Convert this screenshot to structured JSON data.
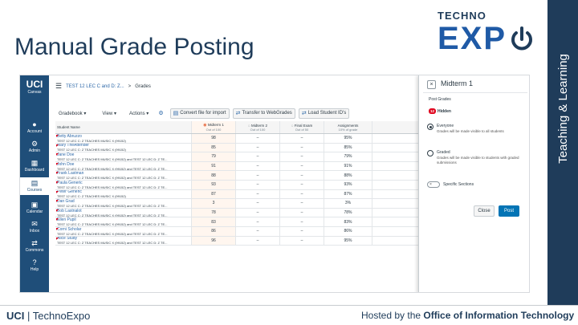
{
  "slide": {
    "title": "Manual Grade Posting",
    "logo_top": "TECHNO",
    "logo_main": "EXP",
    "side_text": "Teaching & Learning",
    "footer_left_a": "UCI",
    "footer_left_b": " | TechnoExpo",
    "footer_right_a": "Hosted by the ",
    "footer_right_b": "Office of Information Technology"
  },
  "nav": {
    "logo": "UCI",
    "logo_sub": "Canvas",
    "items": [
      {
        "label": "Account",
        "icon": "account-icon"
      },
      {
        "label": "Admin",
        "icon": "admin-icon"
      },
      {
        "label": "Dashboard",
        "icon": "dashboard-icon"
      },
      {
        "label": "Courses",
        "icon": "courses-icon"
      },
      {
        "label": "Calendar",
        "icon": "calendar-icon"
      },
      {
        "label": "Inbox",
        "icon": "inbox-icon"
      },
      {
        "label": "Commons",
        "icon": "commons-icon"
      },
      {
        "label": "Help",
        "icon": "help-icon"
      }
    ]
  },
  "breadcrumb": {
    "course": "TEST 12 LEC C and D: Z...",
    "sep": ">",
    "page": "Grades"
  },
  "toolbar": {
    "gradebook": "Gradebook ▾",
    "view": "View ▾",
    "actions": "Actions ▾",
    "convert": "Convert file for import",
    "transfer": "Transfer to WebGrades",
    "load": "Load Student ID's"
  },
  "grid": {
    "headers": [
      {
        "title": "Student Name",
        "sub": ""
      },
      {
        "title": "Midterm 1",
        "sub": "Out of 100"
      },
      {
        "title": "Midterm 2",
        "sub": "Out of 100"
      },
      {
        "title": "Final Exam",
        "sub": "Out of 50"
      },
      {
        "title": "Assignments",
        "sub": "10% of grade"
      }
    ],
    "rows": [
      {
        "name": "Betty Abruzzo",
        "section": "TEST 12 LEC C: Z TEACHES MUSIC X (99152)",
        "m1": "98",
        "m2": "–",
        "fe": "–",
        "as": "95%"
      },
      {
        "name": "Mary TheAttender",
        "section": "TEST 12 LEC C: Z TEACHES MUSIC X (99152)",
        "m1": "85",
        "m2": "–",
        "fe": "–",
        "as": "85%"
      },
      {
        "name": "Jane Doe",
        "section": "TEST 12 LEC C: Z TEACHES MUSIC X (99152) and TEST 12 LEC D: Z TE...",
        "m1": "79",
        "m2": "–",
        "fe": "–",
        "as": "79%"
      },
      {
        "name": "John Doe",
        "section": "TEST 12 LEC C: Z TEACHES MUSIC X (99152) and TEST 12 LEC D: Z TE...",
        "m1": "91",
        "m2": "–",
        "fe": "–",
        "as": "91%"
      },
      {
        "name": "Frank Lastman",
        "section": "TEST 12 LEC C: Z TEACHES MUSIC X (99152) and TEST 12 LEC D: Z TE...",
        "m1": "88",
        "m2": "–",
        "fe": "–",
        "as": "88%"
      },
      {
        "name": "Paula Generic",
        "section": "TEST 12 LEC C: Z TEACHES MUSIC X (99152) and TEST 12 LEC D: Z TE...",
        "m1": "93",
        "m2": "–",
        "fe": "–",
        "as": "93%"
      },
      {
        "name": "Peter Generic",
        "section": "TEST 12 LEC C: Z TEACHES MUSIC X (99152)",
        "m1": "87",
        "m2": "–",
        "fe": "–",
        "as": "87%"
      },
      {
        "name": "Dan Grad",
        "section": "TEST 12 LEC C: Z TEACHES MUSIC X (99152) and TEST 12 LEC D: Z TE...",
        "m1": "3",
        "m2": "–",
        "fe": "–",
        "as": "3%"
      },
      {
        "name": "Bob Lastnalot",
        "section": "TEST 12 LEC C: Z TEACHES MUSIC X (99152) and TEST 12 LEC D: Z TE...",
        "m1": "78",
        "m2": "–",
        "fe": "–",
        "as": "78%"
      },
      {
        "name": "Ellen Pupil",
        "section": "TEST 12 LEC C: Z TEACHES MUSIC X (99152) and TEST 12 LEC D: Z TE...",
        "m1": "83",
        "m2": "–",
        "fe": "–",
        "as": "83%"
      },
      {
        "name": "Corni Scholar",
        "section": "TEST 12 LEC C: Z TEACHES MUSIC X (99152) and TEST 12 LEC D: Z TE...",
        "m1": "86",
        "m2": "–",
        "fe": "–",
        "as": "86%"
      },
      {
        "name": "Alice Study",
        "section": "TEST 12 LEC C: Z TEACHES MUSIC X (99152) and TEST 12 LEC D: Z TE...",
        "m1": "96",
        "m2": "–",
        "fe": "–",
        "as": "95%"
      }
    ]
  },
  "panel": {
    "close": "×",
    "title": "Midterm 1",
    "post_grades": "Post Grades",
    "hidden_count": "12",
    "hidden_label": "Hidden",
    "everyone_title": "Everyone",
    "everyone_desc": "Grades will be made visible to all students",
    "graded_title": "Graded",
    "graded_desc": "Grades will be made visible to students with graded submissions",
    "toggle": "×",
    "specific_sections": "Specific Sections",
    "close_btn": "Close",
    "post_btn": "Post"
  },
  "colors": {
    "nav": "#1f4e79",
    "accent": "#0374b5",
    "hidden_badge": "#e0061f"
  }
}
